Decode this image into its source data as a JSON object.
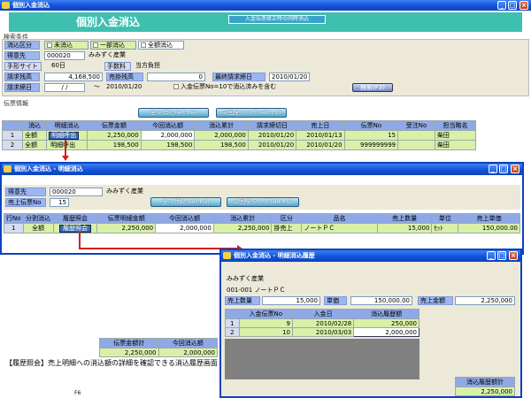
{
  "main": {
    "title": "個別入金消込",
    "heading": "個別入金消込",
    "tip": "入金伝票修正時の同時消込",
    "search_section": "検索条件",
    "kubun_label": "消込区分",
    "kubun_opts": [
      "未消込",
      "一部消込",
      "全額消込"
    ],
    "tokuisaki_label": "得意先",
    "tokuisaki_code": "000020",
    "tokuisaki_name": "みみずく産業",
    "tegata_label": "手形サイト",
    "tegata_value": "60日",
    "tesuryo_label": "手数料",
    "tesuryo_value": "当方負担",
    "seikyu_label": "請求残高",
    "seikyu_value": "4,168,500",
    "uri_label": "売掛残高",
    "uri_value": "0",
    "last_label": "最終請求締日",
    "last_value": "2010/01/20",
    "shime_label": "請求締日",
    "shime_value": "/ /",
    "shime_to": "～",
    "shime_end": "2010/01/20",
    "check_label": "入金伝票No=10で消込済みを含む",
    "search_btn": "検索(F3)",
    "denpyo_section": "伝票情報",
    "all_btn": "全て消込(Alt+A)",
    "clear_btn": "今回全クリア(Alt+C)",
    "cols": [
      "",
      "消込",
      "明細消込",
      "伝票金額",
      "今回消込額",
      "消込累計",
      "請求締切日",
      "売上日",
      "伝票No",
      "受注No",
      "担当略名"
    ],
    "rows": [
      {
        "no": "1",
        "kubun": "全額",
        "btn": "明細呼出",
        "kingaku": "2,250,000",
        "konkai": "2,000,000",
        "ruikei": "2,000,000",
        "shime": "2010/01/20",
        "uriage": "2010/01/13",
        "denpyo": "15",
        "juchu": "",
        "tanto": "柴田"
      },
      {
        "no": "2",
        "kubun": "全額",
        "btn": "明細呼出",
        "kingaku": "198,500",
        "konkai": "198,500",
        "ruikei": "198,500",
        "shime": "2010/01/20",
        "uriage": "2010/01/20",
        "denpyo": "999999999",
        "juchu": "",
        "tanto": "柴田"
      }
    ],
    "foot_cols": [
      "伝票金額計",
      "今回消込額"
    ],
    "foot_vals": [
      "2,250,000",
      "2,000,000"
    ],
    "note": "【履歴照会】売上明細への消込額の詳細を確認できる消込履歴画面",
    "fkey": "F6"
  },
  "meisai": {
    "title": "個別入金消込 - 明細消込",
    "tokuisaki_label": "得意先",
    "tokuisaki_code": "000020",
    "tokuisaki_name": "みみずく産業",
    "denpyo_label": "売上伝票No",
    "denpyo_value": "15",
    "all_btn": "全て消込(Alt+A)",
    "clear_btn": "今回全クリア(Alt+C)",
    "cols": [
      "行No",
      "分割消込",
      "履歴照会",
      "伝票明細金額",
      "今回消込額",
      "消込累計",
      "区分",
      "品名",
      "売上数量",
      "単位",
      "売上単価"
    ],
    "row": {
      "no": "1",
      "kubun": "全額",
      "btn": "履歴照会",
      "kingaku": "2,250,000",
      "konkai": "2,000,000",
      "ruikei": "2,250,000",
      "ku": "掛売上",
      "hinmei": "ノートＰＣ",
      "suryo": "15,000",
      "tani": "ｾｯﾄ",
      "tanka": "150,000.00"
    }
  },
  "rireki": {
    "title": "個別入金消込 - 明細消込履歴",
    "name": "みみずく産業",
    "item": "001-001 ノートＰＣ",
    "suryo_label": "売上数量",
    "suryo_value": "15,000",
    "tanka_label": "単価",
    "tanka_value": "150,000.00",
    "kingaku_label": "売上金額",
    "kingaku_value": "2,250,000",
    "cols": [
      "",
      "入金伝票No",
      "入金日",
      "消込履歴額"
    ],
    "rows": [
      {
        "no": "1",
        "denpyo": "9",
        "date": "2010/02/28",
        "amount": "250,000"
      },
      {
        "no": "2",
        "denpyo": "10",
        "date": "2010/03/03",
        "amount": "2,000,000"
      }
    ],
    "total_label": "消込履歴額計",
    "total_value": "2,250,000"
  }
}
